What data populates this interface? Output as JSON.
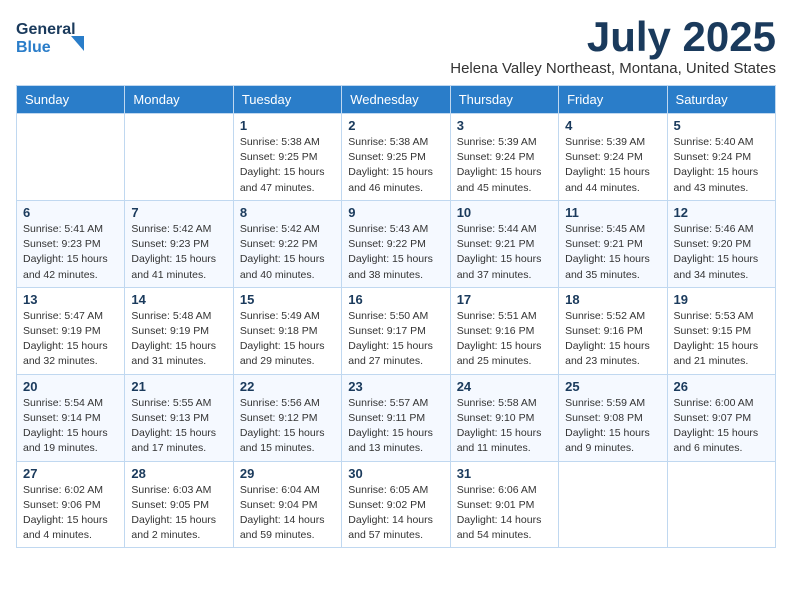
{
  "logo": {
    "line1": "General",
    "line2": "Blue"
  },
  "title": "July 2025",
  "location": "Helena Valley Northeast, Montana, United States",
  "weekdays": [
    "Sunday",
    "Monday",
    "Tuesday",
    "Wednesday",
    "Thursday",
    "Friday",
    "Saturday"
  ],
  "weeks": [
    [
      {
        "day": "",
        "info": ""
      },
      {
        "day": "",
        "info": ""
      },
      {
        "day": "1",
        "info": "Sunrise: 5:38 AM\nSunset: 9:25 PM\nDaylight: 15 hours and 47 minutes."
      },
      {
        "day": "2",
        "info": "Sunrise: 5:38 AM\nSunset: 9:25 PM\nDaylight: 15 hours and 46 minutes."
      },
      {
        "day": "3",
        "info": "Sunrise: 5:39 AM\nSunset: 9:24 PM\nDaylight: 15 hours and 45 minutes."
      },
      {
        "day": "4",
        "info": "Sunrise: 5:39 AM\nSunset: 9:24 PM\nDaylight: 15 hours and 44 minutes."
      },
      {
        "day": "5",
        "info": "Sunrise: 5:40 AM\nSunset: 9:24 PM\nDaylight: 15 hours and 43 minutes."
      }
    ],
    [
      {
        "day": "6",
        "info": "Sunrise: 5:41 AM\nSunset: 9:23 PM\nDaylight: 15 hours and 42 minutes."
      },
      {
        "day": "7",
        "info": "Sunrise: 5:42 AM\nSunset: 9:23 PM\nDaylight: 15 hours and 41 minutes."
      },
      {
        "day": "8",
        "info": "Sunrise: 5:42 AM\nSunset: 9:22 PM\nDaylight: 15 hours and 40 minutes."
      },
      {
        "day": "9",
        "info": "Sunrise: 5:43 AM\nSunset: 9:22 PM\nDaylight: 15 hours and 38 minutes."
      },
      {
        "day": "10",
        "info": "Sunrise: 5:44 AM\nSunset: 9:21 PM\nDaylight: 15 hours and 37 minutes."
      },
      {
        "day": "11",
        "info": "Sunrise: 5:45 AM\nSunset: 9:21 PM\nDaylight: 15 hours and 35 minutes."
      },
      {
        "day": "12",
        "info": "Sunrise: 5:46 AM\nSunset: 9:20 PM\nDaylight: 15 hours and 34 minutes."
      }
    ],
    [
      {
        "day": "13",
        "info": "Sunrise: 5:47 AM\nSunset: 9:19 PM\nDaylight: 15 hours and 32 minutes."
      },
      {
        "day": "14",
        "info": "Sunrise: 5:48 AM\nSunset: 9:19 PM\nDaylight: 15 hours and 31 minutes."
      },
      {
        "day": "15",
        "info": "Sunrise: 5:49 AM\nSunset: 9:18 PM\nDaylight: 15 hours and 29 minutes."
      },
      {
        "day": "16",
        "info": "Sunrise: 5:50 AM\nSunset: 9:17 PM\nDaylight: 15 hours and 27 minutes."
      },
      {
        "day": "17",
        "info": "Sunrise: 5:51 AM\nSunset: 9:16 PM\nDaylight: 15 hours and 25 minutes."
      },
      {
        "day": "18",
        "info": "Sunrise: 5:52 AM\nSunset: 9:16 PM\nDaylight: 15 hours and 23 minutes."
      },
      {
        "day": "19",
        "info": "Sunrise: 5:53 AM\nSunset: 9:15 PM\nDaylight: 15 hours and 21 minutes."
      }
    ],
    [
      {
        "day": "20",
        "info": "Sunrise: 5:54 AM\nSunset: 9:14 PM\nDaylight: 15 hours and 19 minutes."
      },
      {
        "day": "21",
        "info": "Sunrise: 5:55 AM\nSunset: 9:13 PM\nDaylight: 15 hours and 17 minutes."
      },
      {
        "day": "22",
        "info": "Sunrise: 5:56 AM\nSunset: 9:12 PM\nDaylight: 15 hours and 15 minutes."
      },
      {
        "day": "23",
        "info": "Sunrise: 5:57 AM\nSunset: 9:11 PM\nDaylight: 15 hours and 13 minutes."
      },
      {
        "day": "24",
        "info": "Sunrise: 5:58 AM\nSunset: 9:10 PM\nDaylight: 15 hours and 11 minutes."
      },
      {
        "day": "25",
        "info": "Sunrise: 5:59 AM\nSunset: 9:08 PM\nDaylight: 15 hours and 9 minutes."
      },
      {
        "day": "26",
        "info": "Sunrise: 6:00 AM\nSunset: 9:07 PM\nDaylight: 15 hours and 6 minutes."
      }
    ],
    [
      {
        "day": "27",
        "info": "Sunrise: 6:02 AM\nSunset: 9:06 PM\nDaylight: 15 hours and 4 minutes."
      },
      {
        "day": "28",
        "info": "Sunrise: 6:03 AM\nSunset: 9:05 PM\nDaylight: 15 hours and 2 minutes."
      },
      {
        "day": "29",
        "info": "Sunrise: 6:04 AM\nSunset: 9:04 PM\nDaylight: 14 hours and 59 minutes."
      },
      {
        "day": "30",
        "info": "Sunrise: 6:05 AM\nSunset: 9:02 PM\nDaylight: 14 hours and 57 minutes."
      },
      {
        "day": "31",
        "info": "Sunrise: 6:06 AM\nSunset: 9:01 PM\nDaylight: 14 hours and 54 minutes."
      },
      {
        "day": "",
        "info": ""
      },
      {
        "day": "",
        "info": ""
      }
    ]
  ]
}
